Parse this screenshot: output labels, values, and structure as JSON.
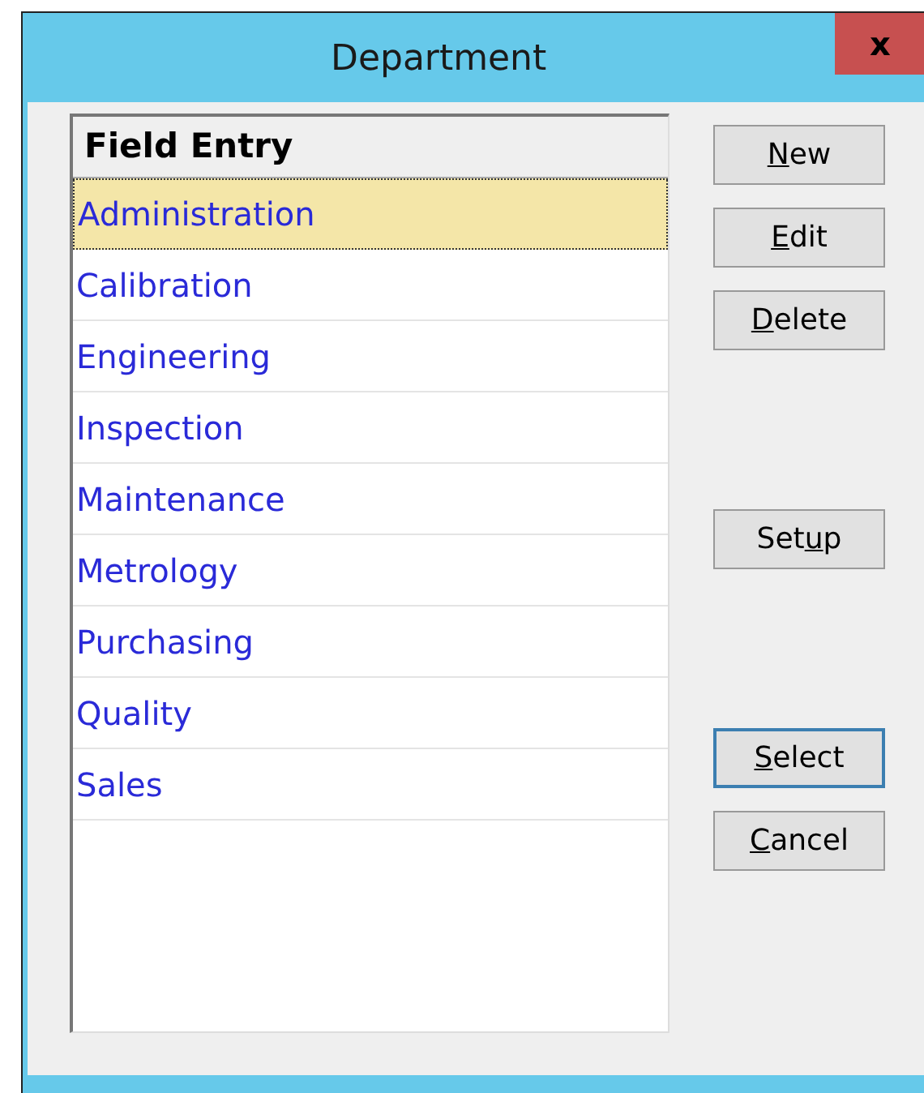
{
  "window": {
    "title": "Department",
    "close": "x"
  },
  "list": {
    "header": "Field Entry",
    "rows": [
      {
        "text": "Administration",
        "selected": true
      },
      {
        "text": "Calibration",
        "selected": false
      },
      {
        "text": "Engineering",
        "selected": false
      },
      {
        "text": "Inspection",
        "selected": false
      },
      {
        "text": "Maintenance",
        "selected": false
      },
      {
        "text": "Metrology",
        "selected": false
      },
      {
        "text": "Purchasing",
        "selected": false
      },
      {
        "text": "Quality",
        "selected": false
      },
      {
        "text": "Sales",
        "selected": false
      }
    ]
  },
  "button_groups": [
    [
      {
        "key": "N",
        "after": "ew",
        "focused": false
      },
      {
        "key": "E",
        "after": "dit",
        "focused": false
      },
      {
        "key": "D",
        "after": "elete",
        "focused": false
      }
    ],
    [
      {
        "before": "Set",
        "key": "u",
        "after": "p",
        "focused": false
      }
    ],
    [
      {
        "key": "S",
        "after": "elect",
        "focused": true
      },
      {
        "key": "C",
        "after": "ancel",
        "focused": false
      }
    ]
  ]
}
